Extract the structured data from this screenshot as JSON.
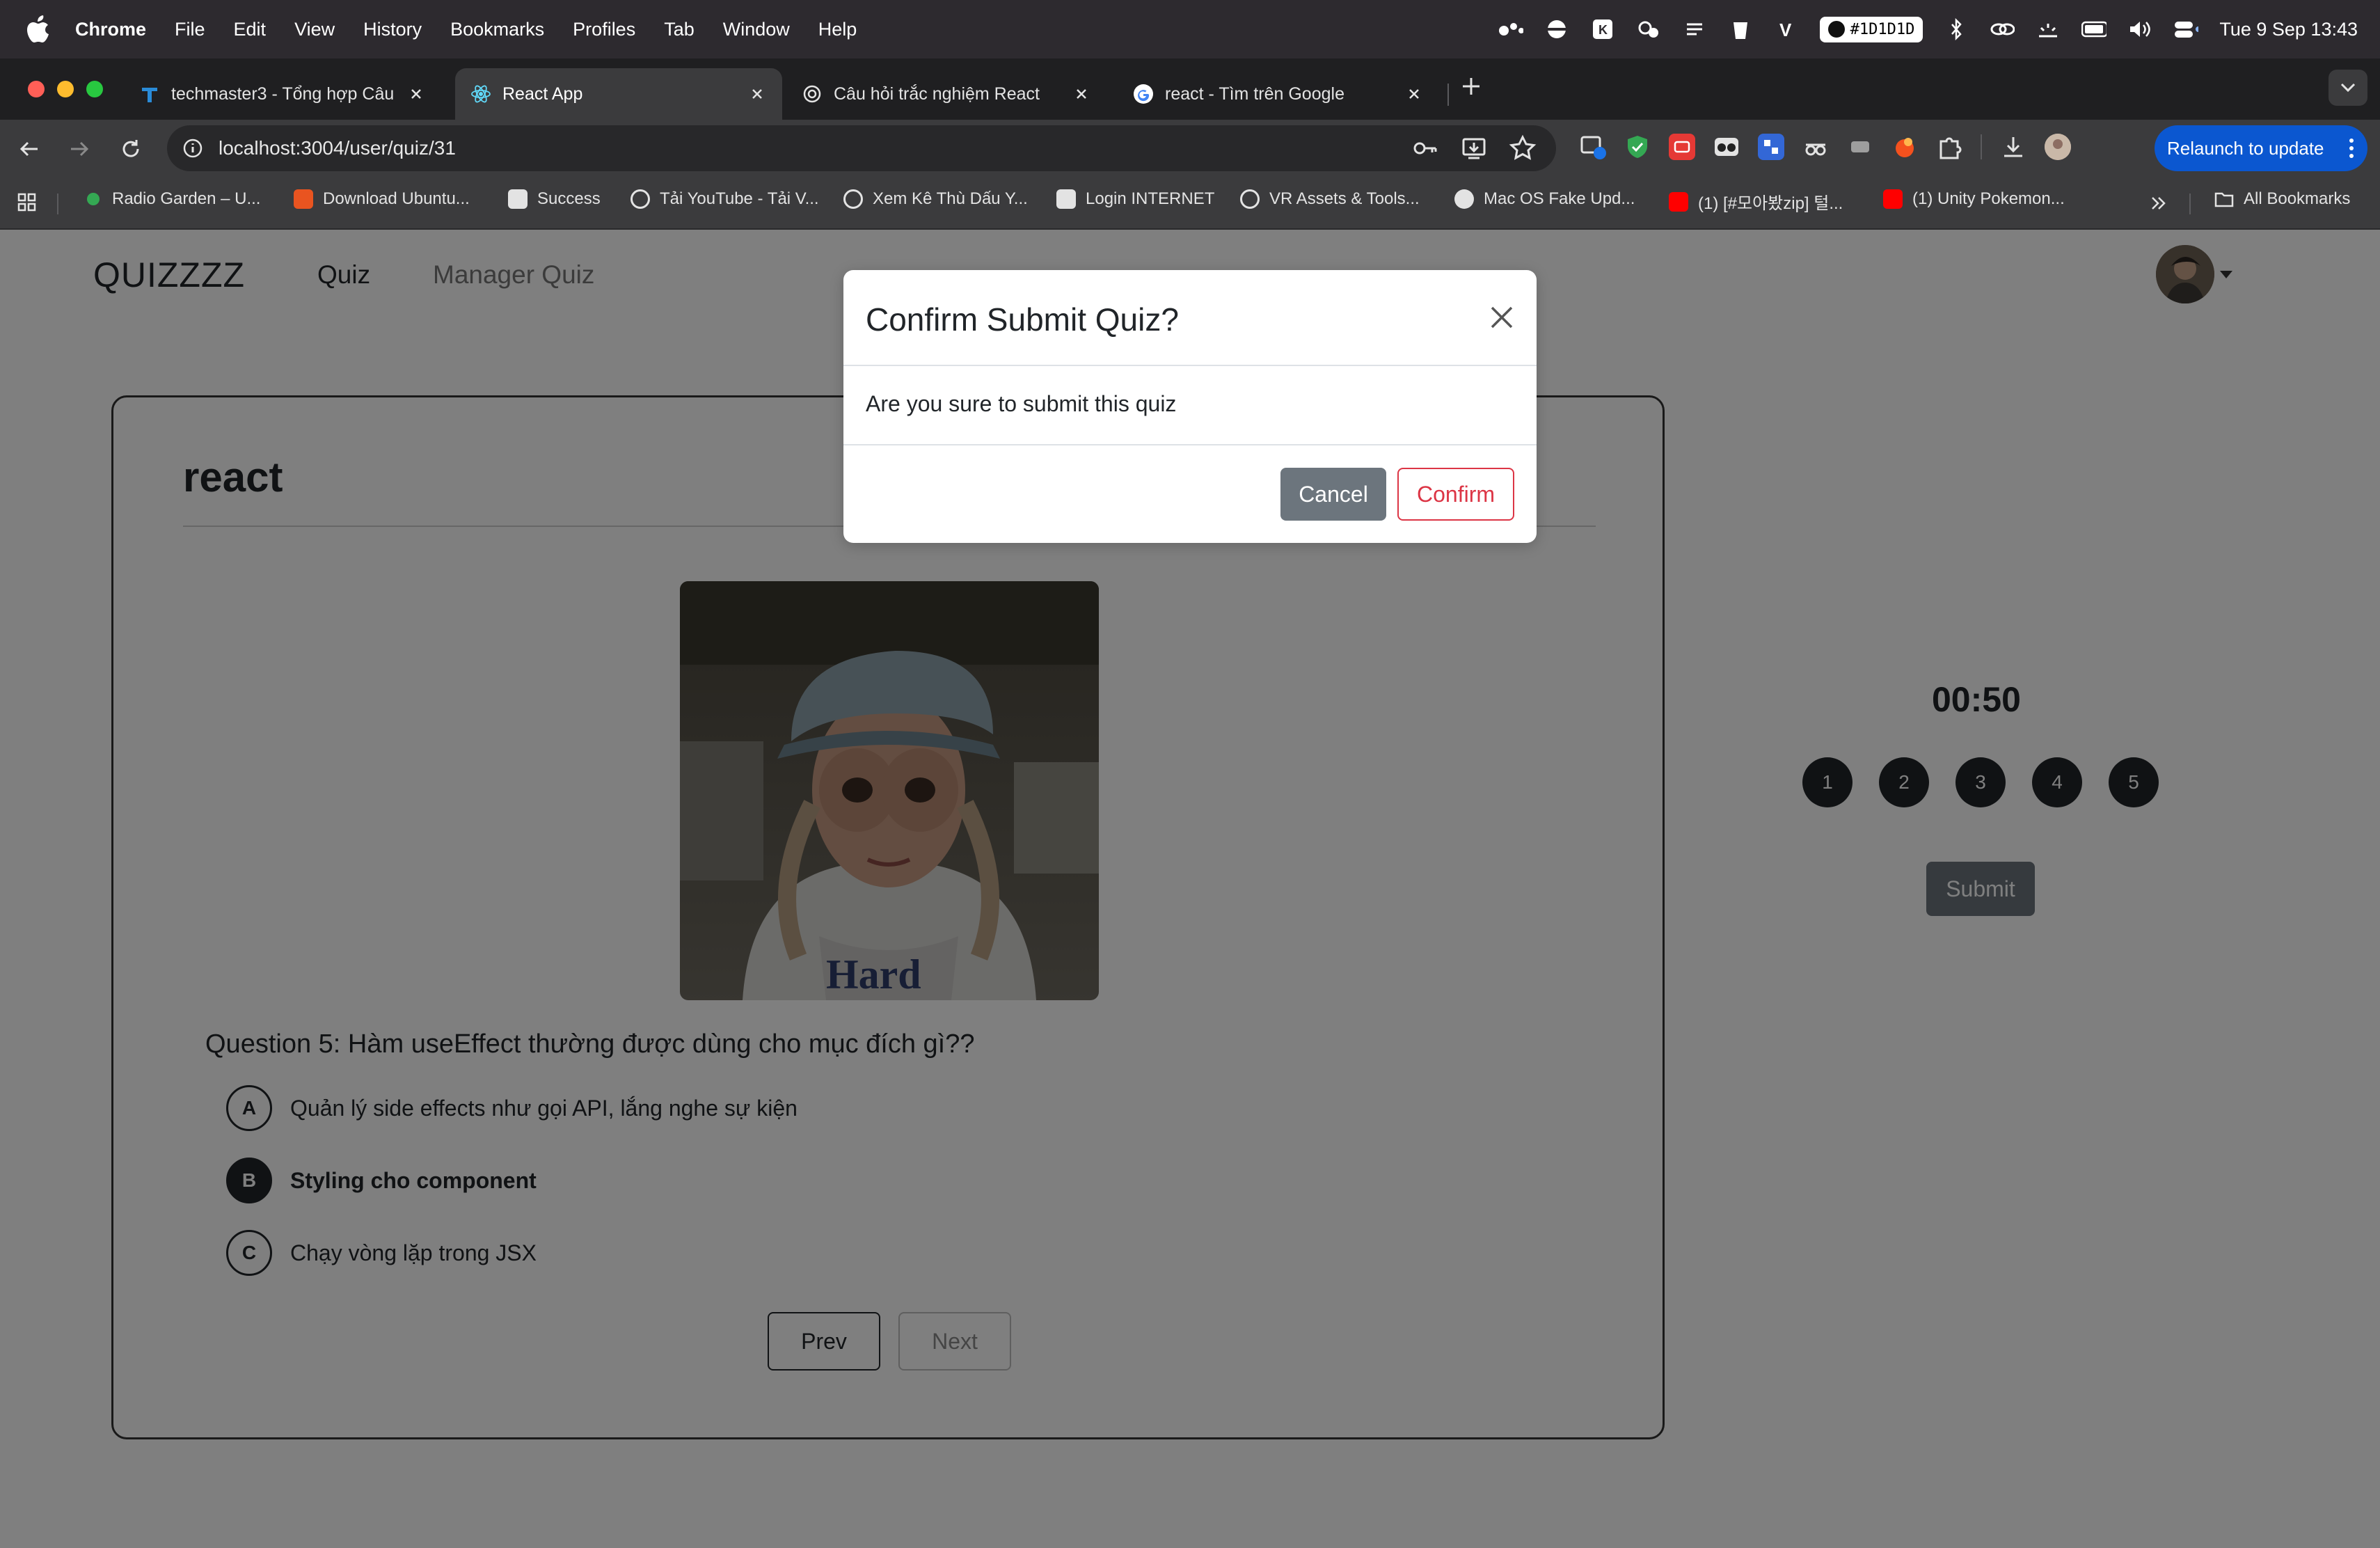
{
  "menubar": {
    "app_name": "Chrome",
    "items": [
      "File",
      "Edit",
      "View",
      "History",
      "Bookmarks",
      "Profiles",
      "Tab",
      "Window",
      "Help"
    ],
    "color_hex": "#1D1D1D",
    "datetime": "Tue 9 Sep  13:43"
  },
  "tabs": [
    {
      "title": "techmaster3 - Tổng hợp Câu",
      "icon": "techmaster-favicon"
    },
    {
      "title": "React App",
      "icon": "react-favicon",
      "active": true
    },
    {
      "title": "Câu hỏi trắc nghiệm React",
      "icon": "openai-favicon"
    },
    {
      "title": "react - Tìm trên Google",
      "icon": "google-favicon"
    }
  ],
  "omnibox": {
    "url": "localhost:3004/user/quiz/31"
  },
  "relaunch_label": "Relaunch to update",
  "bookmarks": [
    "Radio Garden – U...",
    "Download Ubuntu...",
    "Success",
    "Tải YouTube - Tải V...",
    "Xem Kê Thù Dấu Y...",
    "Login INTERNET",
    "VR Assets & Tools...",
    "Mac OS Fake Upd...",
    "(1) [#모아봤zip] 털...",
    "(1) Unity Pokemon..."
  ],
  "all_bookmarks_label": "All Bookmarks",
  "app": {
    "brand": "QUIZZZZ",
    "nav": [
      "Quiz",
      "Manager Quiz"
    ]
  },
  "quiz": {
    "title": "react",
    "question": "Question 5: Hàm useEffect thường được dùng cho mục đích gì??",
    "answers": [
      {
        "letter": "A",
        "text": "Quản lý side effects như gọi API, lắng nghe sự kiện",
        "selected": false
      },
      {
        "letter": "B",
        "text": "Styling cho component",
        "selected": true
      },
      {
        "letter": "C",
        "text": "Chạy vòng lặp trong JSX",
        "selected": false
      }
    ],
    "prev_label": "Prev",
    "next_label": "Next",
    "timer": "00:50",
    "question_numbers": [
      "1",
      "2",
      "3",
      "4",
      "5"
    ],
    "submit_label": "Submit"
  },
  "modal": {
    "title": "Confirm Submit Quiz?",
    "body": "Are you sure to submit this quiz",
    "cancel_label": "Cancel",
    "confirm_label": "Confirm"
  }
}
